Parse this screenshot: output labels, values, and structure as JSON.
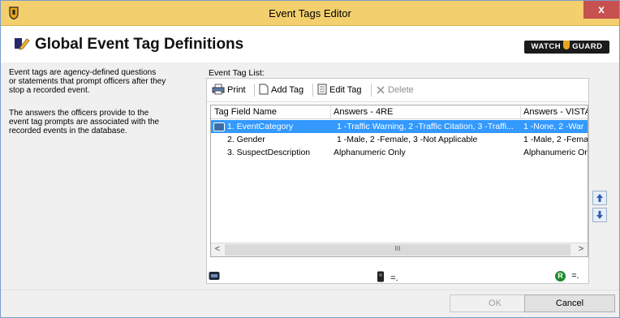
{
  "window": {
    "title": "Event Tags Editor",
    "close_label": "x"
  },
  "header": {
    "title": "Global Event Tag Definitions",
    "logo_text_left": "WATCH",
    "logo_text_right": "GUARD"
  },
  "description": {
    "paragraph1": [
      "Event tags are agency-defined questions",
      "or statements that prompt officers after they",
      "stop a recorded event."
    ],
    "paragraph2": [
      "The answers the officers provide to the",
      "event tag prompts are associated with the",
      "recorded events in the database."
    ]
  },
  "list": {
    "caption": "Event Tag List:",
    "toolbar": {
      "print": "Print",
      "add_tag": "Add Tag",
      "edit_tag": "Edit Tag",
      "delete": "Delete"
    },
    "columns": [
      "Tag Field Name",
      "Answers - 4RE",
      "Answers - VISTA"
    ],
    "rows": [
      {
        "name": "1. EventCategory",
        "answers_4re": "1 -Traffic Warning, 2 -Traffic Citation, 3 -Traffi...",
        "answers_vista": "1 -None, 2 -War",
        "selected": true
      },
      {
        "name": "2. Gender",
        "answers_4re": "1 -Male, 2 -Female, 3 -Not Applicable",
        "answers_vista": "1 -Male, 2 -Fema",
        "selected": false
      },
      {
        "name": "3. SuspectDescription",
        "answers_4re": "Alphanumeric Only",
        "answers_vista": "Alphanumeric On",
        "selected": false
      }
    ],
    "scrollbar": {
      "left_arrow": "<",
      "right_arrow": ">",
      "thumb_grip": "III"
    }
  },
  "legend": {
    "vista_eq": "=.",
    "r_badge": "R",
    "r_eq": "=."
  },
  "buttons": {
    "ok": "OK",
    "cancel": "Cancel"
  },
  "colors": {
    "title_bar": "#f3cf6e",
    "selection": "#3399ff",
    "close": "#c75050",
    "r_badge": "#1e8a2e"
  }
}
